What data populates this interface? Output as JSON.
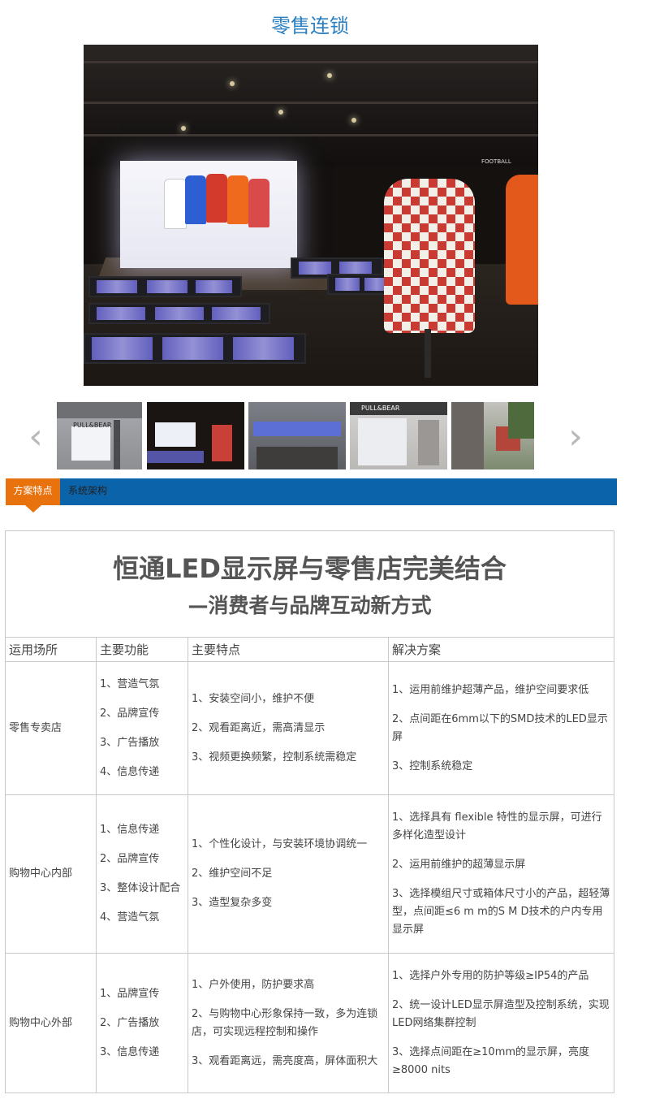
{
  "page": {
    "title": "零售连锁"
  },
  "hero": {
    "sign_text": "FOOTBALL",
    "jersey_colors": [
      "#ffffff",
      "#2d5fd3",
      "#d33a2c",
      "#ef6a1c",
      "#d94a4a"
    ]
  },
  "carousel": {
    "prev_icon": "chevron-left-icon",
    "next_icon": "chevron-right-icon",
    "thumb_text_1": "PULL&BEAR",
    "thumb_text_4": "PULL&BEAR"
  },
  "tabs": [
    {
      "label": "方案特点",
      "active": true
    },
    {
      "label": "系统架构",
      "active": false
    }
  ],
  "colors": {
    "tab_bar": "#0b63a9",
    "tab_active": "#e8720d",
    "title": "#2a7fc0"
  },
  "table": {
    "title": "恒通LED显示屏与零售店完美结合",
    "subtitle": "—消费者与品牌互动新方式",
    "headers": [
      "运用场所",
      "主要功能",
      "主要特点",
      "解决方案"
    ],
    "rows": [
      {
        "place": "零售专卖店",
        "functions": [
          "1、营造气氛",
          "2、品牌宣传",
          "3、广告播放",
          "4、信息传递"
        ],
        "features": [
          "1、安装空间小，维护不便",
          "2、观看距离近，需高清显示",
          "3、视频更换频繁，控制系统需稳定"
        ],
        "solutions": [
          "1、运用前维护超薄产品，维护空间要求低",
          "2、点间距在6mm以下的SMD技术的LED显示屏",
          "3、控制系统稳定"
        ]
      },
      {
        "place": "购物中心内部",
        "functions": [
          "1、信息传递",
          "2、品牌宣传",
          "3、整体设计配合",
          "4、营造气氛"
        ],
        "features": [
          "1、个性化设计，与安装环境协调统一",
          "2、维护空间不足",
          "3、造型复杂多变"
        ],
        "solutions": [
          "1、选择具有 flexible 特性的显示屏，可进行多样化造型设计",
          "2、运用前维护的超薄显示屏",
          "3、选择模组尺寸或箱体尺寸小的产品，超轻薄型，点间距≤6 m m的S M D技术的户内专用显示屏"
        ]
      },
      {
        "place": "购物中心外部",
        "functions": [
          "1、品牌宣传",
          "2、广告播放",
          "3、信息传递"
        ],
        "features": [
          "1、户外使用，防护要求高",
          "2、与购物中心形象保持一致，多为连锁店，可实现远程控制和操作",
          "3、观看距离远，需亮度高，屏体面积大"
        ],
        "solutions": [
          "1、选择户外专用的防护等级≥IP54的产品",
          "2、统一设计LED显示屏造型及控制系统，实现LED网络集群控制",
          "3、选择点间距在≥10mm的显示屏，亮度≥8000 nits"
        ]
      }
    ]
  }
}
